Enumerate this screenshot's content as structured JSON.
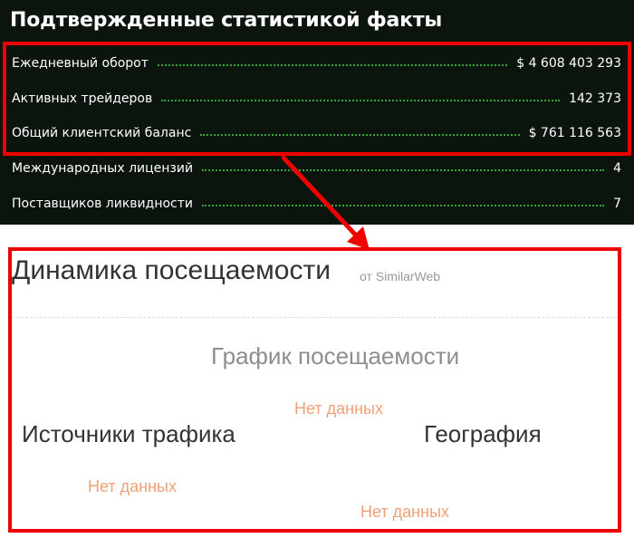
{
  "stats": {
    "title": "Подтвержденные статистикой факты",
    "rows": [
      {
        "label": "Ежедневный оборот",
        "value": "$ 4 608 403 293"
      },
      {
        "label": "Активных трейдеров",
        "value": "142 373"
      },
      {
        "label": "Общий клиентский баланс",
        "value": "$ 761 116 563"
      },
      {
        "label": "Международных лицензий",
        "value": "4"
      },
      {
        "label": "Поставщиков ликвидности",
        "value": "7"
      }
    ]
  },
  "traffic": {
    "title": "Динамика посещаемости",
    "source": "от SimilarWeb",
    "chart_heading": "График посещаемости",
    "chart_no_data": "Нет данных",
    "sources_heading": "Источники трафика",
    "sources_no_data": "Нет данных",
    "geo_heading": "География",
    "geo_no_data": "Нет данных"
  },
  "colors": {
    "panel_bg": "#0c140e",
    "dots": "#3aa63a",
    "highlight": "#ee0000",
    "no_data": "#f0a076"
  }
}
